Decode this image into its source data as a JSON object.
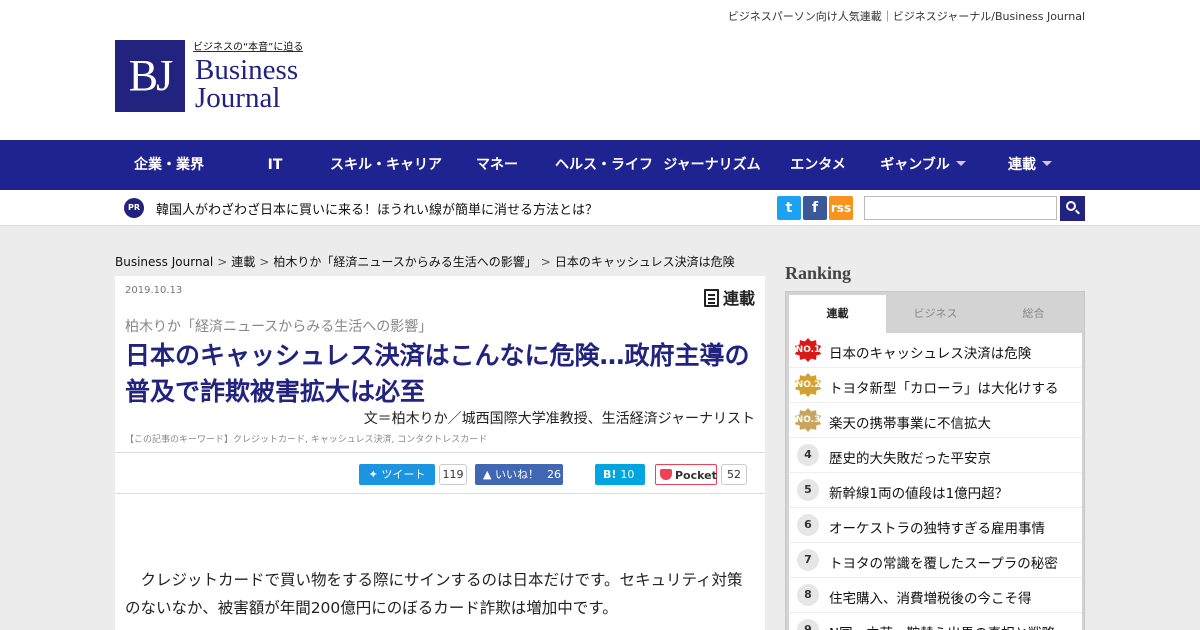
{
  "header": {
    "tagline": "ビジネスパーソン向け人気連載｜ビジネスジャーナル/Business Journal",
    "logo": {
      "mark": "BJ",
      "catch": "ビジネスの“本音”に迫る",
      "word1": "Business",
      "word2": "Journal"
    }
  },
  "nav": {
    "items": [
      {
        "label": "企業・業界",
        "has_dropdown": false
      },
      {
        "label": "IT",
        "has_dropdown": false
      },
      {
        "label": "スキル・キャリア",
        "has_dropdown": false
      },
      {
        "label": "マネー",
        "has_dropdown": false
      },
      {
        "label": "ヘルス・ライフ",
        "has_dropdown": false
      },
      {
        "label": "ジャーナリズム",
        "has_dropdown": false
      },
      {
        "label": "エンタメ",
        "has_dropdown": false
      },
      {
        "label": "ギャンブル",
        "has_dropdown": true
      },
      {
        "label": "連載",
        "has_dropdown": true
      }
    ]
  },
  "pr_bar": {
    "badge": "PR",
    "text": "韓国人がわざわざ日本に買いに来る！ほうれい線が簡単に消せる方法とは？",
    "social": {
      "twitter": "t",
      "facebook": "f",
      "rss": "rss"
    },
    "search": {
      "value": "",
      "placeholder": ""
    }
  },
  "breadcrumb": [
    "Business Journal",
    "連載",
    "柏木りか「経済ニュースからみる生活への影響」",
    "日本のキャッシュレス決済は危険"
  ],
  "article": {
    "date": "2019.10.13",
    "category": "連載",
    "series": "柏木りか「経済ニュースからみる生活への影響」",
    "title": "日本のキャッシュレス決済はこんなに危険…政府主導の普及で詐欺被害拡大は必至",
    "author": "文＝柏木りか／城西国際大学准教授、生活経済ジャーナリスト",
    "keywords": "【この記事のキーワード】クレジットカード, キャッシュレス決済, コンタクトレスカード",
    "share": {
      "tweet_label": "ツイート",
      "tweet_count": "119",
      "like_label": "いいね！",
      "like_count": "26",
      "hatena_label": "B!",
      "hatena_count": "10",
      "pocket_label": "Pocket",
      "pocket_count": "52"
    },
    "body": "クレジットカードで買い物をする際にサインするのは日本だけです。セキュリティ対策のないなか、被害額が年間200億円にのぼるカード詐欺は増加中です。"
  },
  "ranking": {
    "heading": "Ranking",
    "tabs": [
      {
        "label": "連載",
        "active": true
      },
      {
        "label": "ビジネス",
        "active": false
      },
      {
        "label": "総合",
        "active": false
      }
    ],
    "items": [
      {
        "rank": "NO.1",
        "medal": "gold",
        "title": "日本のキャッシュレス決済は危険"
      },
      {
        "rank": "NO.2",
        "medal": "silver",
        "title": "トヨタ新型「カローラ」は大化けする"
      },
      {
        "rank": "NO.3",
        "medal": "bronze",
        "title": "楽天の携帯事業に不信拡大"
      },
      {
        "rank": "4",
        "medal": "",
        "title": "歴史的大失敗だった平安京"
      },
      {
        "rank": "5",
        "medal": "",
        "title": "新幹線1両の値段は1億円超？"
      },
      {
        "rank": "6",
        "medal": "",
        "title": "オーケストラの独特すぎる雇用事情"
      },
      {
        "rank": "7",
        "medal": "",
        "title": "トヨタの常識を覆したスープラの秘密"
      },
      {
        "rank": "8",
        "medal": "",
        "title": "住宅購入、消費増税後の今こそ得"
      },
      {
        "rank": "9",
        "medal": "",
        "title": "N国・立花、鞍替え出馬の真相と戦略"
      }
    ]
  }
}
